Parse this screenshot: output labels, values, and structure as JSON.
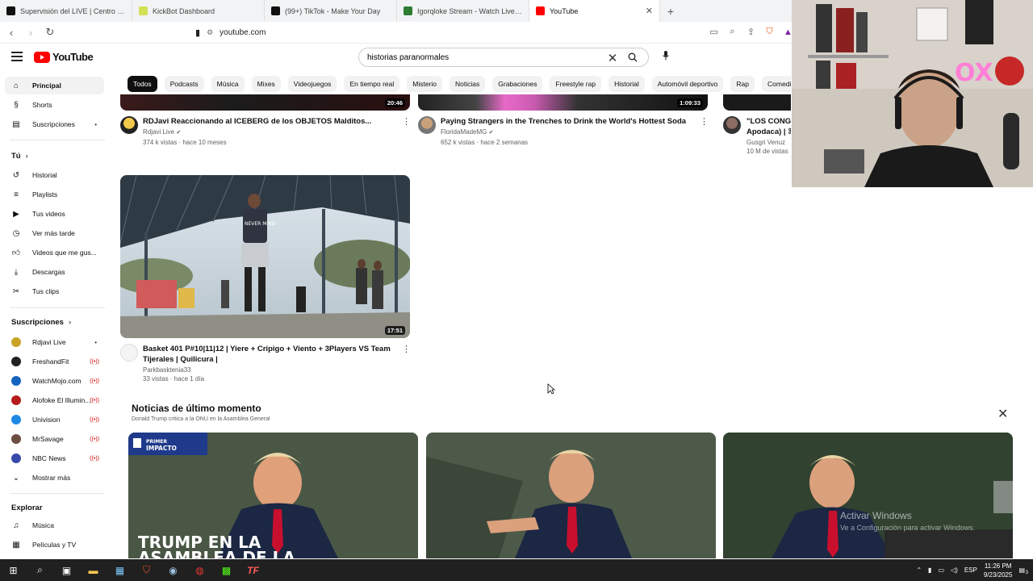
{
  "browser": {
    "tabs": [
      {
        "title": "Supervisión del LIVE | Centro LIVE de",
        "favicon": "tiktok-icon",
        "active": false
      },
      {
        "title": "KickBot Dashboard",
        "favicon": "kickbot-icon",
        "active": false
      },
      {
        "title": "(99+) TikTok - Make Your Day",
        "favicon": "tiktok-icon",
        "active": false
      },
      {
        "title": "Igorqloke Stream - Watch Live on Kic",
        "favicon": "kick-icon",
        "active": false
      },
      {
        "title": "YouTube",
        "favicon": "youtube-icon",
        "active": true
      }
    ],
    "url": "youtube.com"
  },
  "youtube": {
    "logo_text": "YouTube",
    "search": {
      "value": "historias paranormales"
    },
    "chips": [
      "Todos",
      "Podcasts",
      "Música",
      "Mixes",
      "Videojuegos",
      "En tiempo real",
      "Misterio",
      "Noticias",
      "Grabaciones",
      "Freestyle rap",
      "Historial",
      "Automóvil deportivo",
      "Rap",
      "Comedias"
    ],
    "sidebar": {
      "main": [
        {
          "label": "Principal",
          "icon": "home-icon",
          "active": true
        },
        {
          "label": "Shorts",
          "icon": "shorts-icon"
        },
        {
          "label": "Suscripciones",
          "icon": "subscriptions-icon",
          "dot": "•"
        }
      ],
      "you_header": "Tú",
      "you": [
        {
          "label": "Historial",
          "icon": "history-icon"
        },
        {
          "label": "Playlists",
          "icon": "playlists-icon"
        },
        {
          "label": "Tus videos",
          "icon": "your-videos-icon"
        },
        {
          "label": "Ver más tarde",
          "icon": "watch-later-icon"
        },
        {
          "label": "Videos que me gus...",
          "icon": "like-icon"
        },
        {
          "label": "Descargas",
          "icon": "download-icon"
        },
        {
          "label": "Tus clips",
          "icon": "clips-icon"
        }
      ],
      "subs_header": "Suscripciones",
      "subs": [
        {
          "label": "Rdjavi Live",
          "color": "#c9a227",
          "badge": "•"
        },
        {
          "label": "FreshandFit",
          "color": "#222222",
          "badge": "((•))"
        },
        {
          "label": "WatchMojo.com",
          "color": "#1565c0",
          "badge": "((•))"
        },
        {
          "label": "Alofoke El Illumin...",
          "color": "#b71c1c",
          "badge": "((•))"
        },
        {
          "label": "Univision",
          "color": "#1e88e5",
          "badge": "((•))"
        },
        {
          "label": "MrSavage",
          "color": "#6d4c41",
          "badge": "((•))"
        },
        {
          "label": "NBC News",
          "color": "#3949ab",
          "badge": "((•))"
        }
      ],
      "show_more": "Mostrar más",
      "explore_header": "Explorar",
      "explore": [
        {
          "label": "Música",
          "icon": "music-icon"
        },
        {
          "label": "Películas y TV",
          "icon": "movies-icon"
        }
      ]
    },
    "videos_top": [
      {
        "title": "RDJavi Reaccionando al ICEBERG de los OBJETOS Malditos...",
        "channel": "Rdjavi Live",
        "verified": "✔",
        "stats": "374 k vistas · hace 10 meses",
        "duration": "20:46"
      },
      {
        "title": "Paying Strangers in the Trenches to Drink the World's Hottest Soda",
        "channel": "FloridaMadeMG",
        "verified": "✔",
        "stats": "652 k vistas · hace 2 semanas",
        "duration": "1:09:33"
      },
      {
        "title": "\"LOS CONGE",
        "title2": "Apodaca) | ⌘",
        "channel": "Gusgri Venuz",
        "stats": "10 M de vistas"
      }
    ],
    "video_main": {
      "title": "Basket 401 P#10|11|12 | Yiere + Cripigo + Viento + 3Players VS Team Tijerales  | Quilicura |",
      "channel": "Parkbasktenia33",
      "stats": "33 vistas · hace 1 día",
      "duration": "17:51",
      "shirt_text": "NEVER MIND"
    },
    "news": {
      "title": "Noticias de último momento",
      "subtitle": "Donald Trump critica a la ONU en la Asamblea General",
      "card1_badge_line1": "PRIMER",
      "card1_badge_line2": "IMPACTO",
      "card1_headline_line1": "TRUMP EN LA",
      "card1_headline_line2": "ASAMBLEA DE LA"
    }
  },
  "overlay": {
    "watermark_title": "Activar Windows",
    "watermark_sub": "Ve a Configuración para activar Windows.",
    "neon_text": "OX"
  },
  "taskbar": {
    "lang": "ESP",
    "time": "11:26 PM",
    "date": "9/23/2025",
    "notifications": "3"
  }
}
